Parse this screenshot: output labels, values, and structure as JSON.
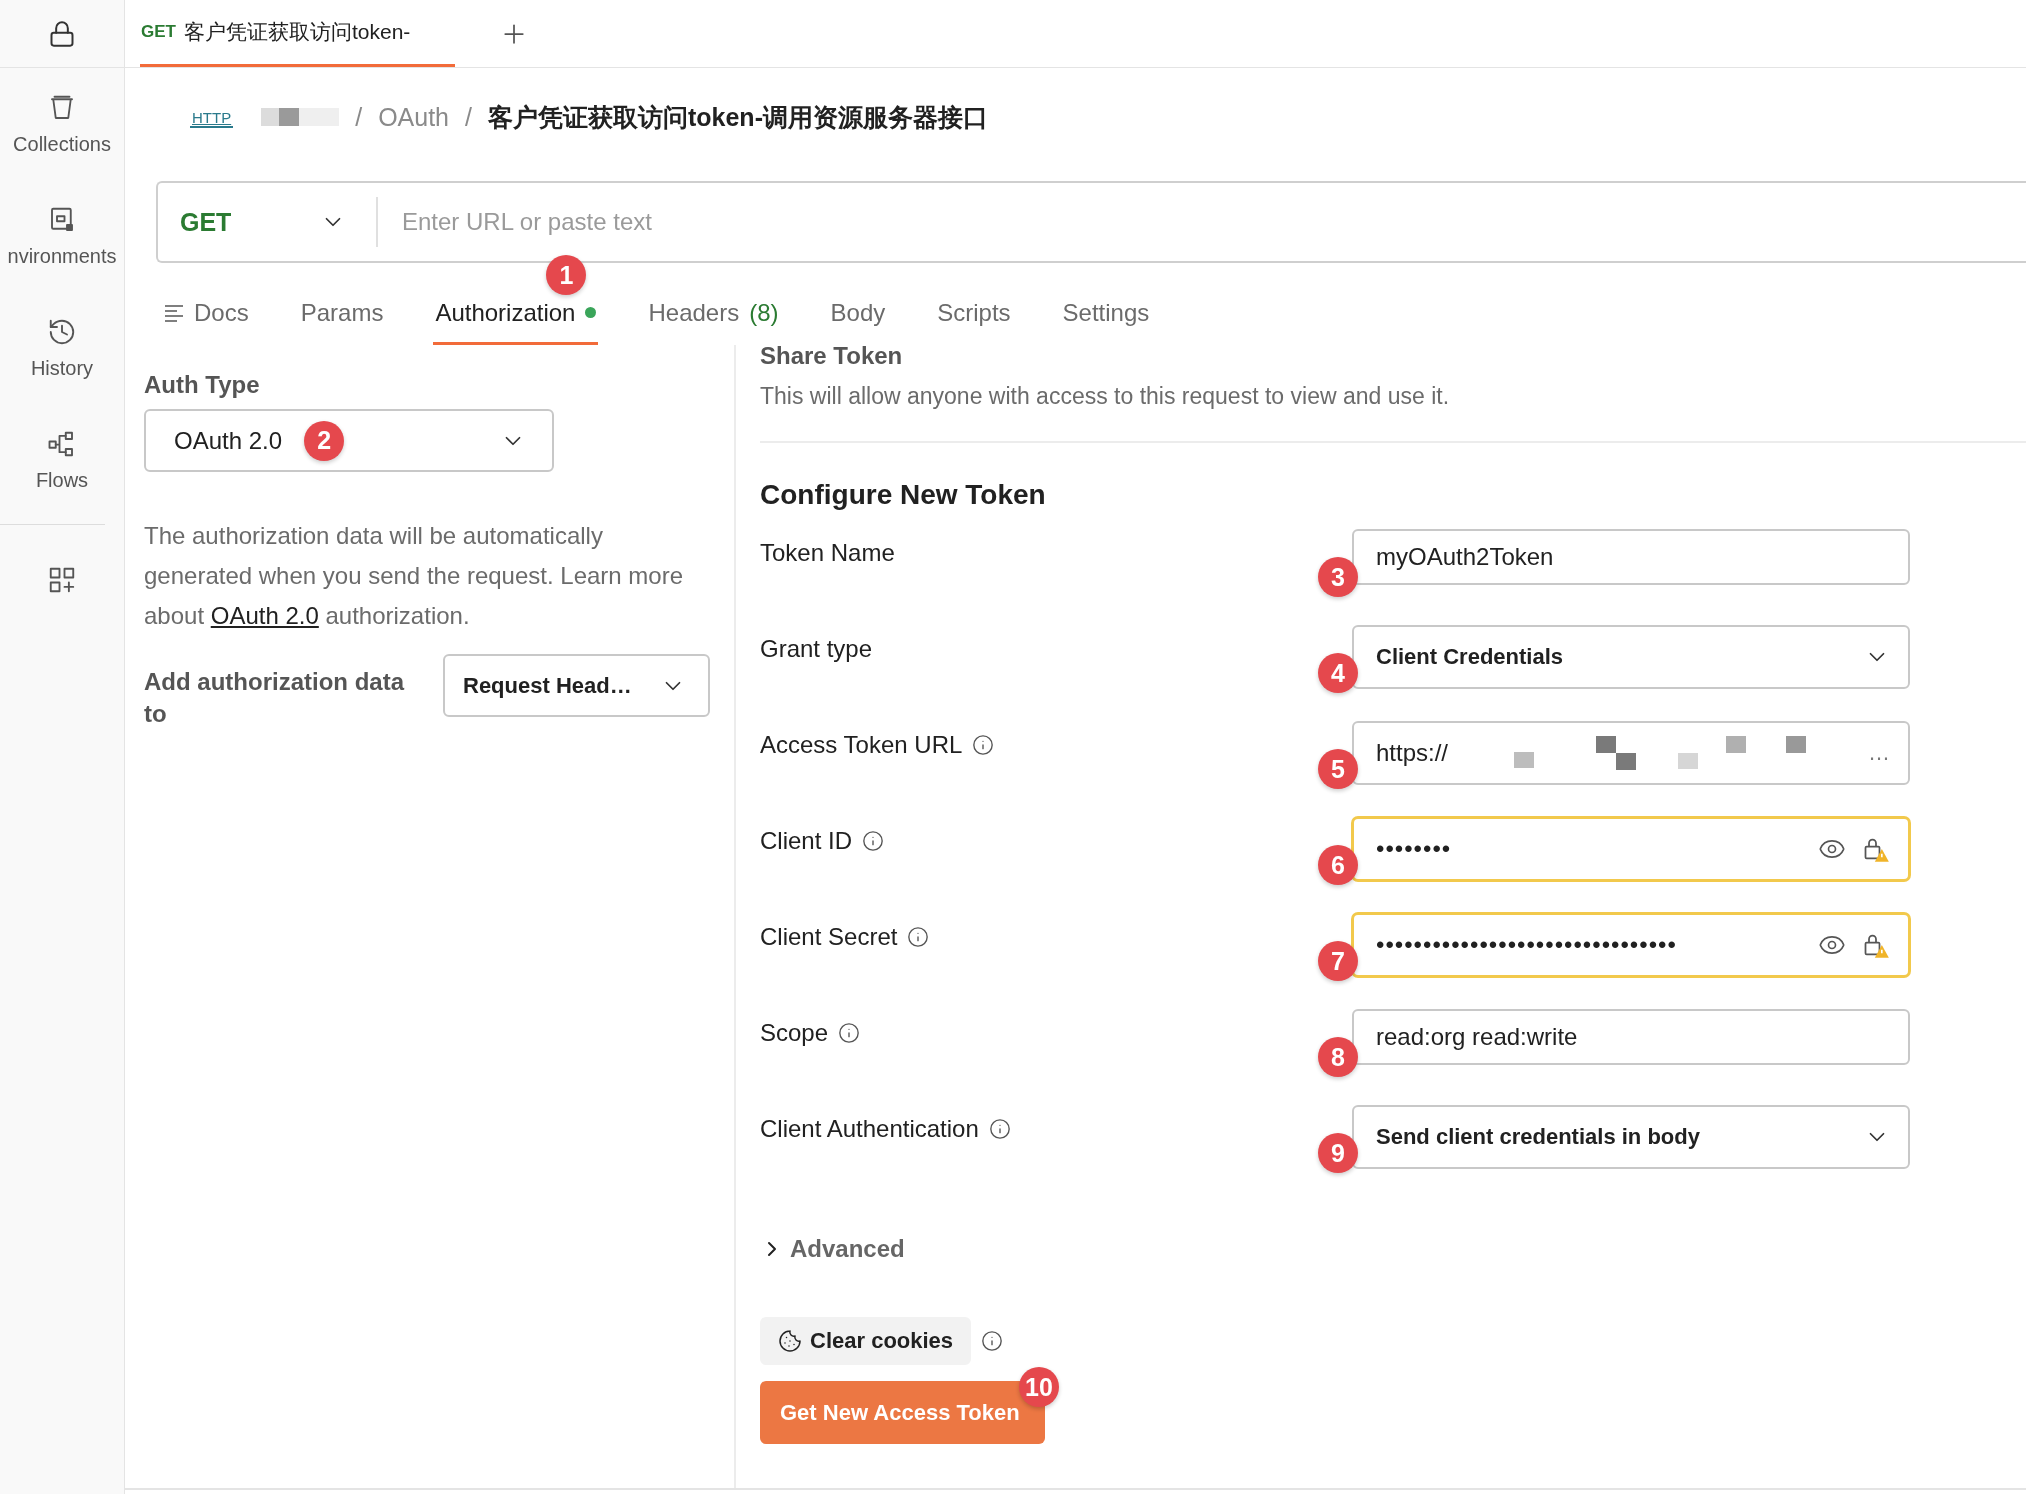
{
  "sidebar": {
    "items": [
      {
        "kind": "lock"
      },
      {
        "kind": "collections",
        "label": "Collections"
      },
      {
        "kind": "environments",
        "label": "nvironments"
      },
      {
        "kind": "history",
        "label": "History"
      },
      {
        "kind": "flows",
        "label": "Flows"
      },
      {
        "kind": "apps"
      }
    ]
  },
  "request_tab": {
    "method": "GET",
    "title": "客户凭证获取访问token-",
    "selected": true
  },
  "breadcrumb": {
    "icon_text": "HTTP",
    "separator": "/",
    "segments": [
      {
        "kind": "redacted"
      },
      {
        "kind": "text",
        "text": "OAuth"
      },
      {
        "kind": "current",
        "text": "客户凭证获取访问token-调用资源服务器接口"
      }
    ]
  },
  "url_bar": {
    "method": "GET",
    "placeholder": "Enter URL or paste text"
  },
  "request_tabs": [
    {
      "label": "Docs",
      "selected": false,
      "kind": "docs"
    },
    {
      "label": "Params",
      "selected": false
    },
    {
      "label": "Authorization",
      "selected": true,
      "status_dot": true,
      "badge": "1"
    },
    {
      "label": "Headers",
      "selected": false,
      "count": "(8)"
    },
    {
      "label": "Body",
      "selected": false
    },
    {
      "label": "Scripts",
      "selected": false
    },
    {
      "label": "Settings",
      "selected": false
    }
  ],
  "auth": {
    "label": "Auth Type",
    "select": {
      "value": "OAuth 2.0",
      "badge": "2"
    },
    "description": "The authorization data will be automatically generated when you send the request. Learn more about ",
    "link": "OAuth 2.0",
    "description_end": " authorization.",
    "add_to": {
      "label": "Add authorization data to",
      "value": "Request Head…"
    }
  },
  "share_token": {
    "title": "Share Token",
    "text": "This will allow anyone with access to this request to view and use it."
  },
  "configure": {
    "title": "Configure New Token",
    "rows": [
      {
        "label": "Token Name",
        "kind": "text",
        "value": "myOAuth2Token",
        "badge": "3",
        "info": false,
        "warning": false
      },
      {
        "label": "Grant type",
        "kind": "select",
        "value": "Client Credentials",
        "badge": "4",
        "info": false,
        "warning": false
      },
      {
        "label": "Access Token URL",
        "kind": "url",
        "value": "https://",
        "ellipsis": "…",
        "badge": "5",
        "info": true,
        "warning": false
      },
      {
        "label": "Client ID",
        "kind": "secret",
        "value": "••••••••",
        "badge": "6",
        "info": true,
        "warning": true
      },
      {
        "label": "Client Secret",
        "kind": "secret",
        "value": "••••••••••••••••••••••••••••••••",
        "badge": "7",
        "info": true,
        "warning": true
      },
      {
        "label": "Scope",
        "kind": "text",
        "value": "read:org read:write",
        "badge": "8",
        "info": true,
        "warning": false
      },
      {
        "label": "Client Authentication",
        "kind": "select",
        "value": "Send client credentials in body",
        "badge": "9",
        "info": true,
        "warning": false
      }
    ]
  },
  "advanced": {
    "label": "Advanced",
    "expanded": false
  },
  "clear_cookies": {
    "label": "Clear cookies",
    "info": true
  },
  "get_token": {
    "label": "Get New Access Token",
    "badge": "10"
  }
}
